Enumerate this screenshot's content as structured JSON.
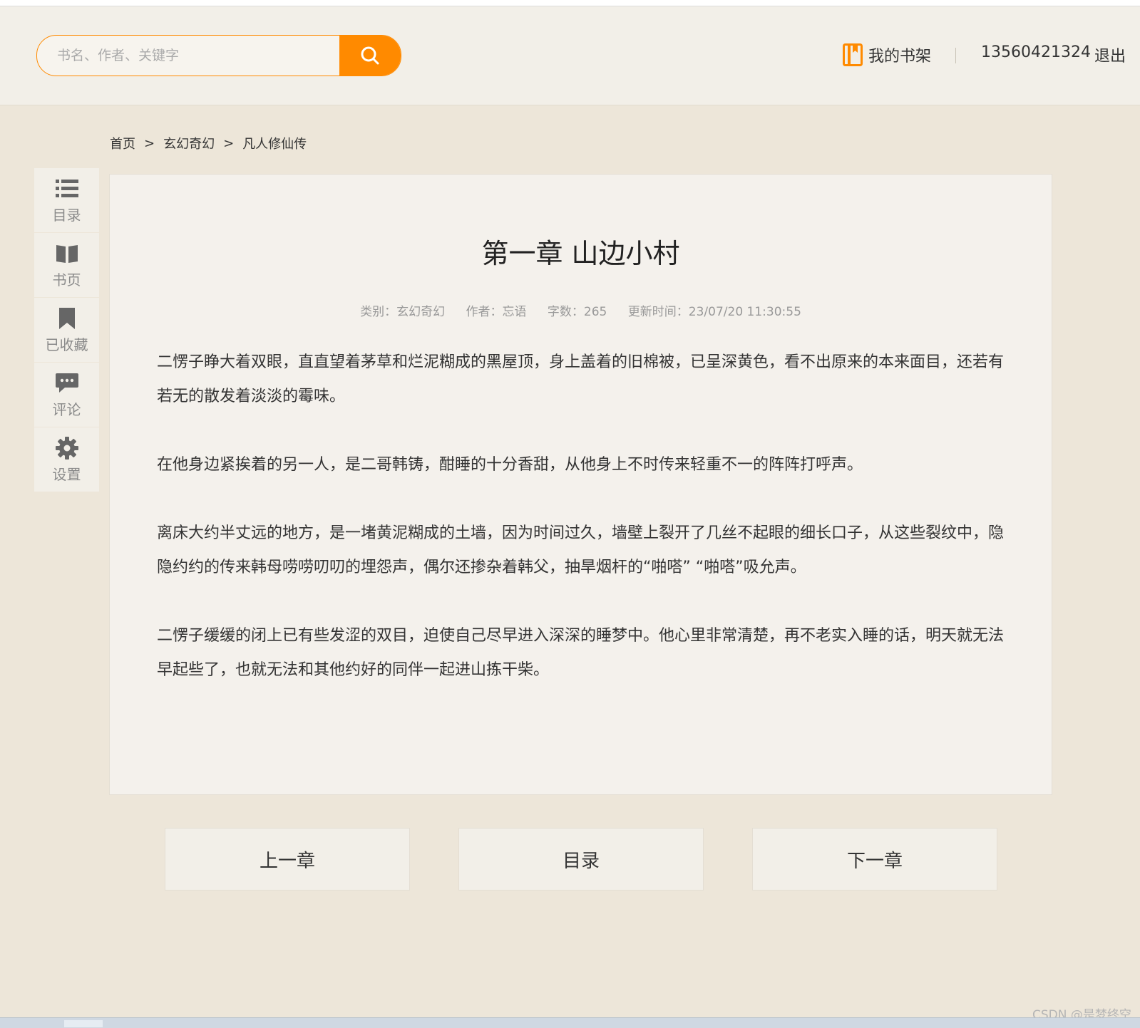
{
  "header": {
    "search_placeholder": "书名、作者、关键字",
    "bookshelf_label": "我的书架",
    "user_phone": "13560421324",
    "logout_label": "退出"
  },
  "breadcrumb": {
    "home": "首页",
    "separator": ">",
    "category": "玄幻奇幻",
    "book": "凡人修仙传"
  },
  "sidebar": {
    "items": [
      {
        "label": "目录",
        "icon": "list-icon"
      },
      {
        "label": "书页",
        "icon": "book-icon"
      },
      {
        "label": "已收藏",
        "icon": "bookmark-icon"
      },
      {
        "label": "评论",
        "icon": "comment-icon"
      },
      {
        "label": "设置",
        "icon": "gear-icon"
      }
    ]
  },
  "chapter": {
    "title": "第一章 山边小村",
    "meta": {
      "category": "类别：玄幻奇幻",
      "author": "作者：忘语",
      "word_count": "字数：265",
      "updated": "更新时间：23/07/20 11:30:55"
    },
    "paragraphs": [
      "二愣子睁大着双眼，直直望着茅草和烂泥糊成的黑屋顶，身上盖着的旧棉被，已呈深黄色，看不出原来的本来面目，还若有若无的散发着淡淡的霉味。",
      "在他身边紧挨着的另一人，是二哥韩铸，酣睡的十分香甜，从他身上不时传来轻重不一的阵阵打呼声。",
      "离床大约半丈远的地方，是一堵黄泥糊成的土墙，因为时间过久，墙壁上裂开了几丝不起眼的细长口子，从这些裂纹中，隐隐约约的传来韩母唠唠叨叨的埋怨声，偶尔还掺杂着韩父，抽旱烟杆的“啪嗒” “啪嗒”吸允声。",
      "二愣子缓缓的闭上已有些发涩的双目，迫使自己尽早进入深深的睡梦中。他心里非常清楚，再不老实入睡的话，明天就无法早起些了，也就无法和其他约好的同伴一起进山拣干柴。"
    ]
  },
  "nav": {
    "prev": "上一章",
    "toc": "目录",
    "next": "下一章"
  },
  "watermark": "CSDN @是梦终空",
  "colors": {
    "accent": "#ff8a00",
    "page_bg": "#ede6d9",
    "panel_bg": "#f4f1ec"
  }
}
